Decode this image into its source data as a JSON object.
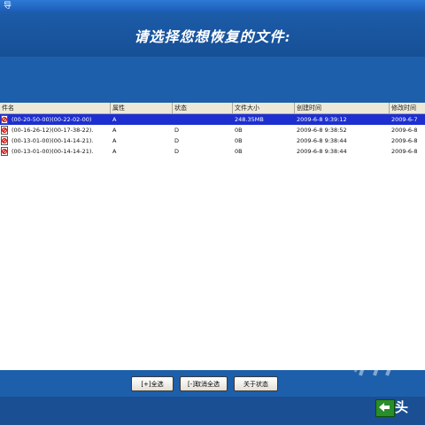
{
  "window": {
    "title_fragment": "导"
  },
  "banner": {
    "title": "请选择您想恢复的文件:"
  },
  "table": {
    "columns": [
      "件名",
      "属性",
      "状态",
      "文件大小",
      "创建时间",
      "修改时间"
    ],
    "rows": [
      {
        "name": "(00-20-50-00)(00-22-02-00)",
        "attr": "A",
        "status": "",
        "size": "248.35MB",
        "created": "2009-6-8 9:39:12",
        "modified": "2009-6-7",
        "selected": true
      },
      {
        "name": "(00-16-26-12)(00-17-38-22).",
        "attr": "A",
        "status": "D",
        "size": "0B",
        "created": "2009-6-8 9:38:52",
        "modified": "2009-6-8",
        "selected": false
      },
      {
        "name": "(00-13-01-00)(00-14-14-21).",
        "attr": "A",
        "status": "D",
        "size": "0B",
        "created": "2009-6-8 9:38:44",
        "modified": "2009-6-8",
        "selected": false
      },
      {
        "name": "(00-13-01-00)(00-14-14-21).",
        "attr": "A",
        "status": "D",
        "size": "0B",
        "created": "2009-6-8 9:38:44",
        "modified": "2009-6-8",
        "selected": false
      }
    ]
  },
  "buttons": {
    "select_all": "[+]全选",
    "deselect_all": "[-]取消全选",
    "about_status": "关于状态"
  },
  "watermark": {
    "text": "头"
  },
  "icons": {
    "file": "file-icon",
    "back": "back-arrow-icon"
  }
}
